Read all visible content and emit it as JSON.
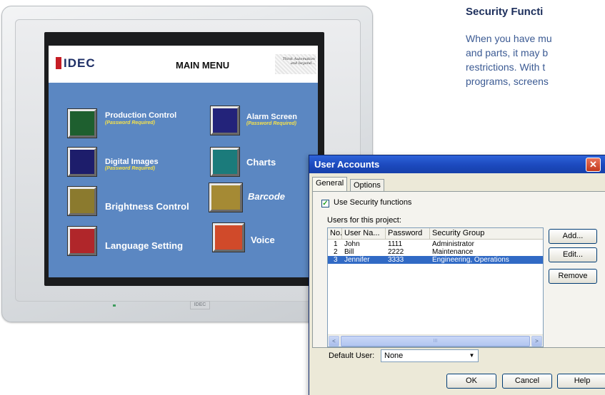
{
  "article": {
    "heading": "Security Functi",
    "body_lines": [
      "When you have mu",
      "and parts, it may b",
      "restrictions. With t",
      "programs, screens"
    ]
  },
  "hmi": {
    "logo": "IDEC",
    "title": "MAIN MENU",
    "tagline_1": "Think Automation",
    "tagline_2": "and beyond...",
    "front_badge": "IDEC",
    "buttons": [
      {
        "label": "Production Control",
        "note": "(Password Required)",
        "color": "#1e5f2f"
      },
      {
        "label": "Digital Images",
        "note": "(Password Required)",
        "color": "#1d1d6b"
      },
      {
        "label": "Brightness Control",
        "note": "",
        "color": "#8b7a2e"
      },
      {
        "label": "Language Setting",
        "note": "",
        "color": "#b0262a"
      },
      {
        "label": "Alarm Screen",
        "note": "(Password Required)",
        "color": "#23237a"
      },
      {
        "label": "Charts",
        "note": "",
        "color": "#1b7b7b"
      },
      {
        "label": "Barcode",
        "note": "",
        "color": "#a58a34"
      },
      {
        "label": "Voice",
        "note": "",
        "color": "#d04a2a"
      }
    ],
    "screen_color": "#5b87c2"
  },
  "dialog": {
    "title": "User Accounts",
    "close_glyph": "✕",
    "tabs": [
      "General",
      "Options"
    ],
    "use_security_label": "Use Security functions",
    "use_security_checked": "✓",
    "users_label": "Users for this project:",
    "columns": [
      "No.",
      "User Na...",
      "Password",
      "Security Group"
    ],
    "rows": [
      {
        "no": "1",
        "user": "John",
        "password": "1111",
        "group": "Administrator"
      },
      {
        "no": "2",
        "user": "Bill",
        "password": "2222",
        "group": "Maintenance"
      },
      {
        "no": "3",
        "user": "Jennifer",
        "password": "3333",
        "group": "Engineering, Operations"
      }
    ],
    "selected_row": 3,
    "scroll_left": "<",
    "scroll_right": ">",
    "scroll_grip": "III",
    "buttons": {
      "add": "Add...",
      "edit": "Edit...",
      "remove": "Remove"
    },
    "default_user_label": "Default User:",
    "default_user_value": "None",
    "dropdown_glyph": "▼",
    "footer": {
      "ok": "OK",
      "cancel": "Cancel",
      "help": "Help"
    },
    "titlebar_color": "#1c49bd",
    "selection_color": "#316ac5"
  }
}
